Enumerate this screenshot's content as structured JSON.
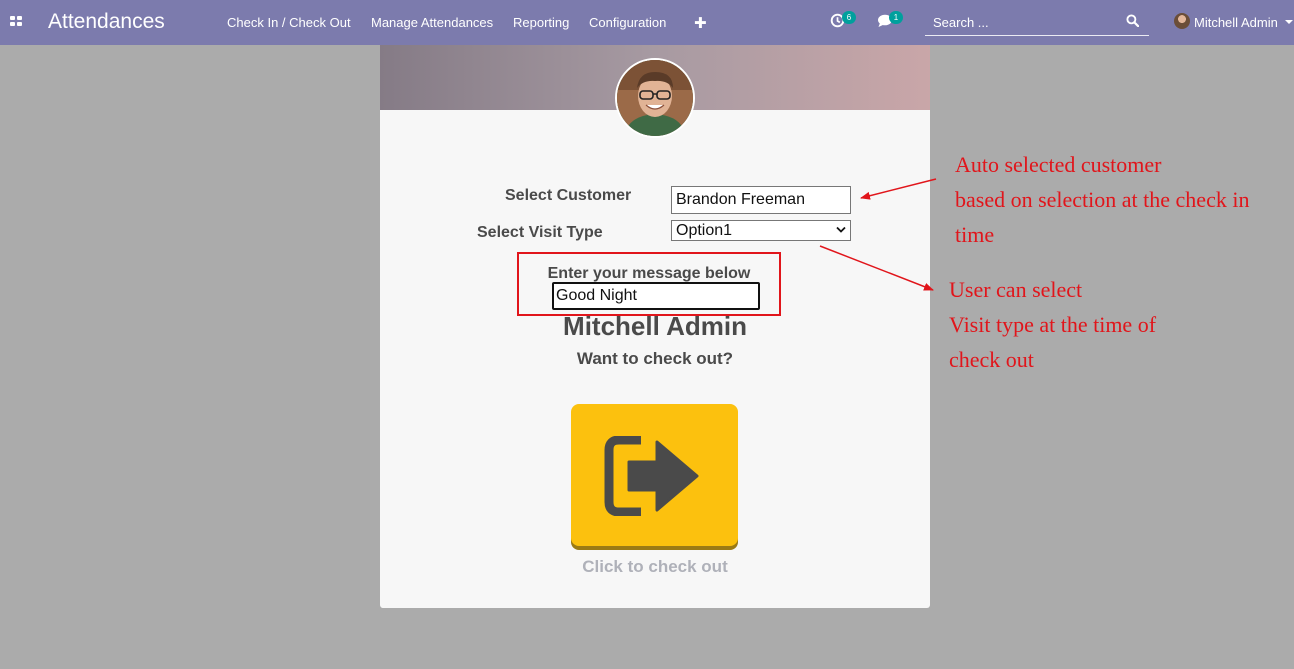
{
  "navbar": {
    "app_title": "Attendances",
    "menu": [
      "Check In / Check Out",
      "Manage Attendances",
      "Reporting",
      "Configuration"
    ],
    "activity_count": "6",
    "message_count": "1",
    "search_placeholder": "Search ...",
    "user_name": "Mitchell Admin",
    "colors": {
      "bar": "#7c7bad",
      "badge": "#00a09d"
    }
  },
  "form": {
    "customer_label": "Select Customer",
    "customer_value": "Brandon Freeman",
    "visit_type_label": "Select Visit Type",
    "visit_type_value": "Option1",
    "message_label": "Enter your message below",
    "message_value": "Good Night"
  },
  "checkout": {
    "employee_name": "Mitchell Admin",
    "question": "Want to check out?",
    "button_hint": "Click to check out",
    "button_color": "#fcc10e"
  },
  "annotations": {
    "customer_lines": [
      "Auto selected customer",
      "based on selection at the check in",
      "time"
    ],
    "visit_type_lines": [
      "User can select",
      "Visit type at the time of",
      "check out"
    ],
    "color": "#e1151b"
  }
}
